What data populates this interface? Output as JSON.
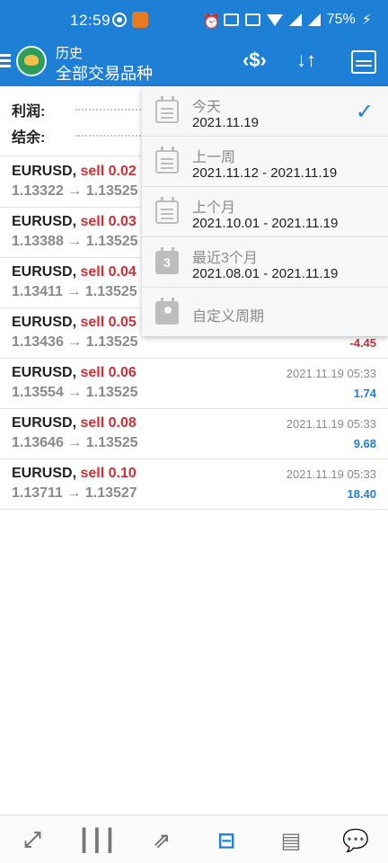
{
  "status_bar": {
    "time": "12:59",
    "battery": "75%"
  },
  "appbar": {
    "subtitle": "历史",
    "title": "全部交易品种"
  },
  "summary": {
    "profit_label": "利润:",
    "balance_label": "结余:"
  },
  "trades": [
    {
      "symbol": "EURUSD,",
      "side": "sell 0.02",
      "prices": "1.13322 → 1.13525",
      "date": "",
      "profit": ""
    },
    {
      "symbol": "EURUSD,",
      "side": "sell 0.03",
      "prices": "1.13388 → 1.13525",
      "date": "",
      "profit": ""
    },
    {
      "symbol": "EURUSD,",
      "side": "sell 0.04",
      "prices": "1.13411 → 1.13525",
      "date": "",
      "profit": ""
    },
    {
      "symbol": "EURUSD,",
      "side": "sell 0.05",
      "prices": "1.13436 → 1.13525",
      "date": "",
      "profit": "-4.45",
      "negative": true
    },
    {
      "symbol": "EURUSD,",
      "side": "sell 0.06",
      "prices": "1.13554 → 1.13525",
      "date": "2021.11.19 05:33",
      "profit": "1.74"
    },
    {
      "symbol": "EURUSD,",
      "side": "sell 0.08",
      "prices": "1.13646 → 1.13525",
      "date": "2021.11.19 05:33",
      "profit": "9.68"
    },
    {
      "symbol": "EURUSD,",
      "side": "sell 0.10",
      "prices": "1.13711 → 1.13527",
      "date": "2021.11.19 05:33",
      "profit": "18.40"
    }
  ],
  "period_menu": {
    "items": [
      {
        "label": "今天",
        "range": "2021.11.19",
        "selected": true,
        "icon": "calendar-day-icon"
      },
      {
        "label": "上一周",
        "range": "2021.11.12 - 2021.11.19",
        "icon": "calendar-week-icon"
      },
      {
        "label": "上个月",
        "range": "2021.10.01 - 2021.11.19",
        "icon": "calendar-month-icon"
      },
      {
        "label": "最近3个月",
        "range": "2021.08.01 - 2021.11.19",
        "icon": "calendar-3-months-icon",
        "badge": "3"
      },
      {
        "label": "自定义周期",
        "range": "",
        "icon": "calendar-custom-icon"
      }
    ]
  },
  "bottom_nav": [
    "quotes-icon",
    "chart-icon",
    "trade-icon",
    "history-icon",
    "news-icon",
    "messages-icon"
  ],
  "colors": {
    "primary": "#1e7fd6",
    "sell": "#cc2f35",
    "muted": "#8a8a8a"
  }
}
